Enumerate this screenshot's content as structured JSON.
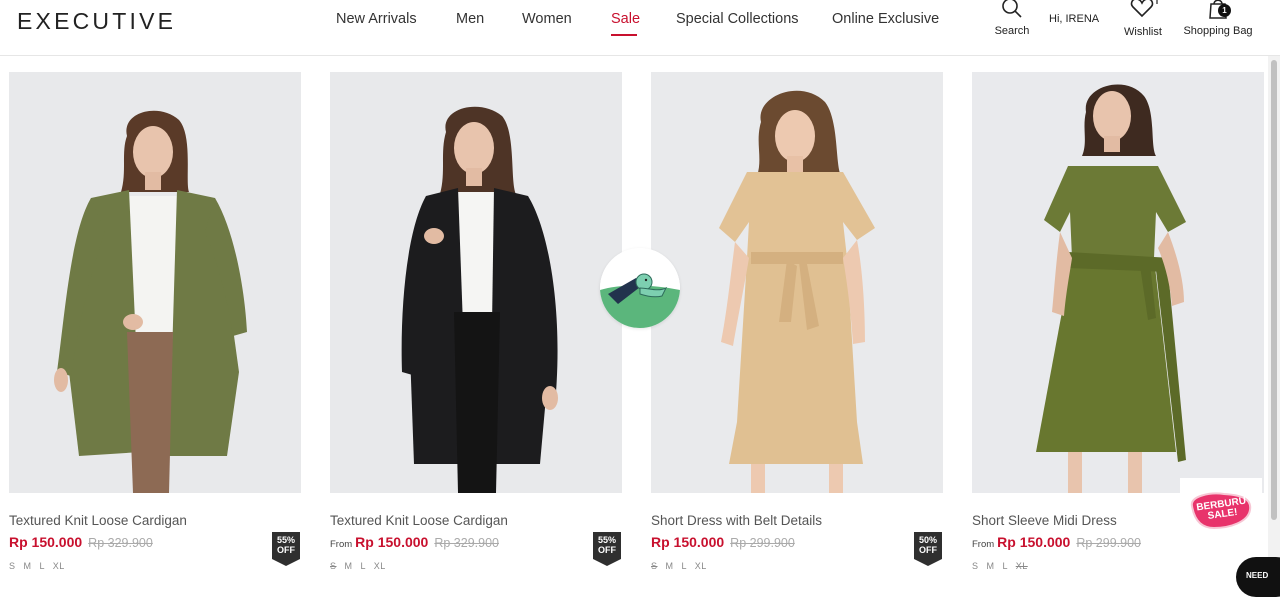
{
  "header": {
    "logo": "EXECUTIVE",
    "nav": [
      {
        "label": "New Arrivals"
      },
      {
        "label": "Men"
      },
      {
        "label": "Women"
      },
      {
        "label": "Sale"
      },
      {
        "label": "Special Collections"
      },
      {
        "label": "Online Exclusive"
      }
    ],
    "active_nav": "Sale",
    "search_label": "Search",
    "greeting": "Hi, IRENA",
    "wishlist_label": "Wishlist",
    "bag_label": "Shopping Bag",
    "bag_count": "1",
    "accent_color": "#c8102e"
  },
  "products": [
    {
      "name": "Textured Knit Loose Cardigan",
      "from": "",
      "price": "Rp 150.000",
      "old_price": "Rp 329.900",
      "discount": "55%",
      "discount_suffix": "OFF",
      "sizes": [
        "S",
        "M",
        "L",
        "XL"
      ],
      "image": "woman-olive-cardigan"
    },
    {
      "name": "Textured Knit Loose Cardigan",
      "from": "From",
      "price": "Rp 150.000",
      "old_price": "Rp 329.900",
      "discount": "55%",
      "discount_suffix": "OFF",
      "sizes": [
        "S",
        "M",
        "L",
        "XL"
      ],
      "image": "woman-black-cardigan"
    },
    {
      "name": "Short Dress with Belt Details",
      "from": "",
      "price": "Rp 150.000",
      "old_price": "Rp 299.900",
      "discount": "50%",
      "discount_suffix": "OFF",
      "sizes": [
        "S",
        "M",
        "L",
        "XL"
      ],
      "image": "woman-beige-dress"
    },
    {
      "name": "Short Sleeve Midi Dress",
      "from": "From",
      "price": "Rp 150.000",
      "old_price": "Rp 299.900",
      "sizes": [
        "S",
        "M",
        "L",
        "XL"
      ],
      "image": "woman-olive-midi-dress"
    }
  ],
  "promo_sticker": {
    "line1": "BERBURU",
    "line2": "SALE!"
  },
  "help_button": "NEED"
}
